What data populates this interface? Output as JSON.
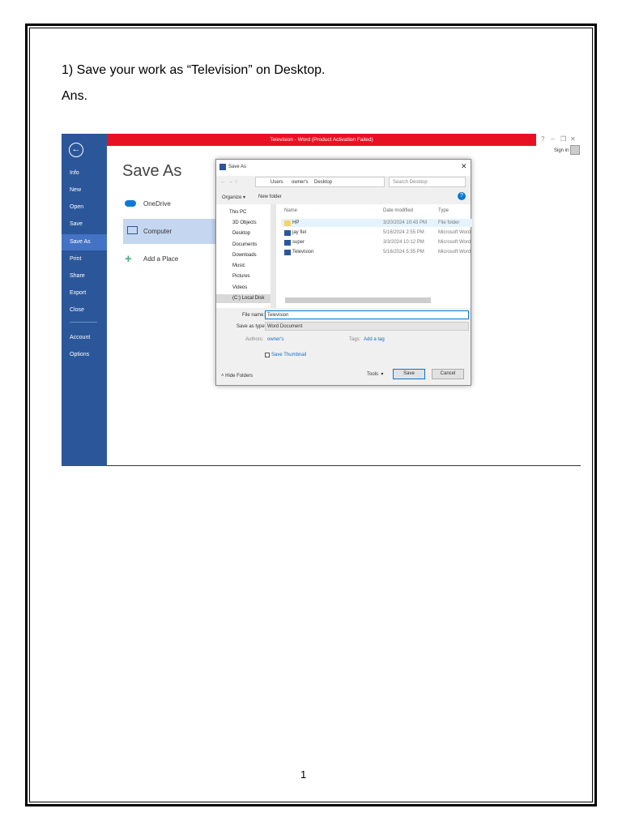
{
  "question": "1) Save your work as “Television” on Desktop.",
  "answer_label": "Ans.",
  "page_number": "1",
  "word": {
    "title": "Television - Word (Product Activation Failed)",
    "window_controls": [
      "?",
      "–",
      "❐",
      "✕"
    ],
    "sign_in": "Sign in",
    "sidebar": [
      "Info",
      "New",
      "Open",
      "Save",
      "Save As",
      "Print",
      "Share",
      "Export",
      "Close",
      "Account",
      "Options"
    ],
    "heading": "Save As",
    "locations": [
      "OneDrive",
      "Computer",
      "Add a Place"
    ]
  },
  "dialog": {
    "title": "Save As",
    "breadcrumb": [
      "Users",
      "owner's",
      "Desktop"
    ],
    "search_placeholder": "Search Desktop",
    "organize": "Organize ▾",
    "new_folder": "New folder",
    "nav": [
      "This PC",
      "3D Objects",
      "Desktop",
      "Documents",
      "Downloads",
      "Music",
      "Pictures",
      "Videos",
      "(C:) Local Disk"
    ],
    "columns": [
      "Name",
      "Date modified",
      "Type"
    ],
    "files": [
      {
        "name": "HP",
        "date": "3/20/2024 10:43 PM",
        "type": "File folder"
      },
      {
        "name": "jay fiel",
        "date": "5/16/2024 2:55 PM",
        "type": "Microsoft Word"
      },
      {
        "name": "super",
        "date": "3/3/2024 10:12 PM",
        "type": "Microsoft Word"
      },
      {
        "name": "Television",
        "date": "5/16/2024 5:35 PM",
        "type": "Microsoft Word"
      }
    ],
    "file_name_label": "File name:",
    "file_name": "Television",
    "save_type_label": "Save as type:",
    "save_type": "Word Document",
    "authors_label": "Authors:",
    "authors": "owner's",
    "tags_label": "Tags:",
    "tags": "Add a tag",
    "thumbnail": "Save Thumbnail",
    "hide_folders": "Hide Folders",
    "tools": "Tools",
    "save": "Save",
    "cancel": "Cancel"
  }
}
